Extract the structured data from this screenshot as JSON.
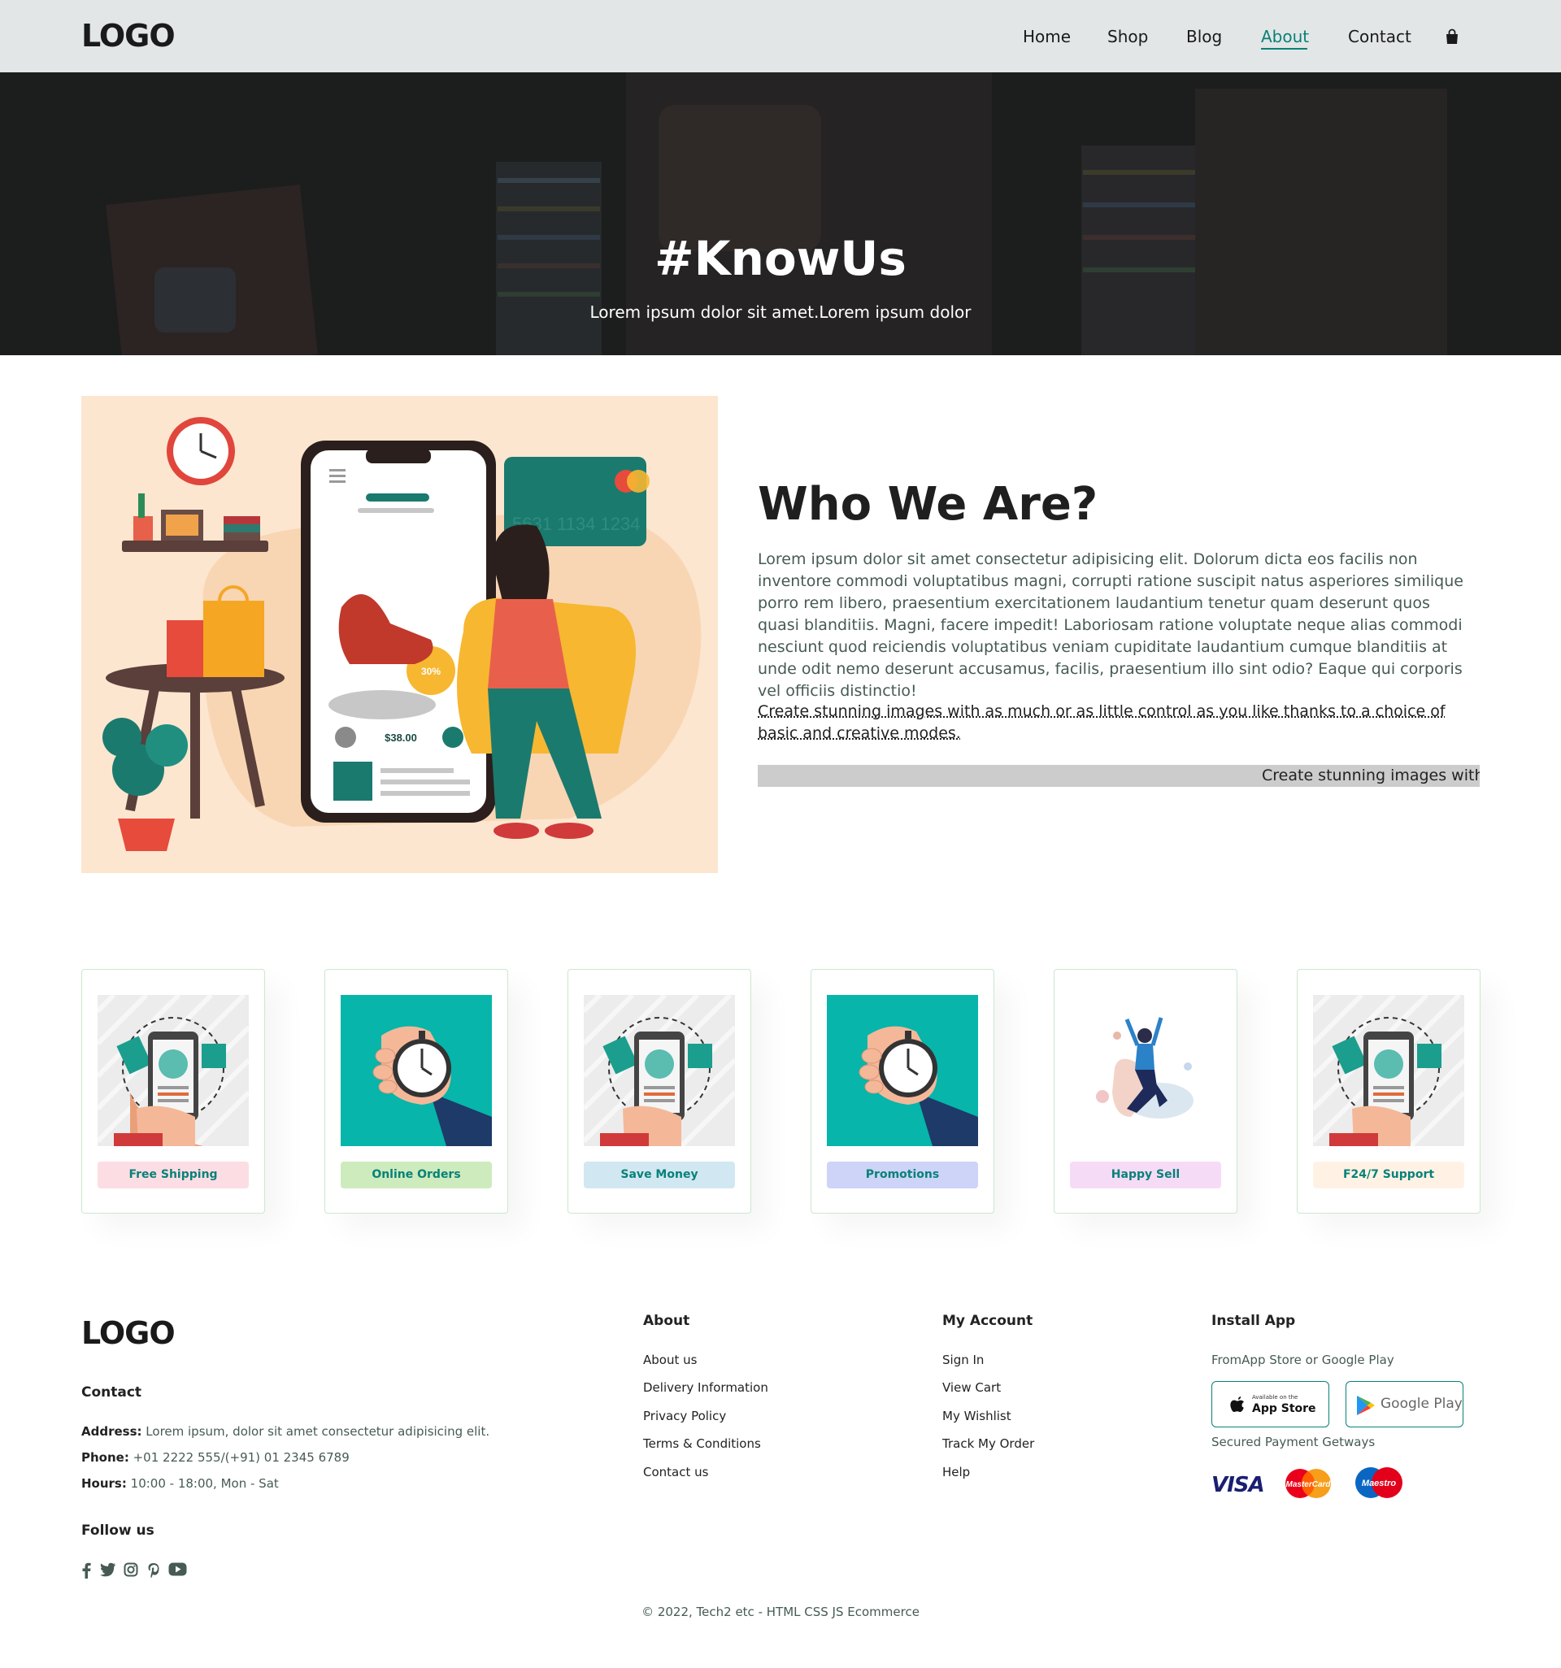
{
  "header": {
    "logo": "LOGO",
    "nav": [
      "Home",
      "Shop",
      "Blog",
      "About",
      "Contact"
    ],
    "active": "About",
    "cart_icon": "shopping-bag-icon"
  },
  "hero": {
    "title": "#KnowUs",
    "subtitle": "Lorem ipsum dolor sit amet.Lorem ipsum dolor"
  },
  "about": {
    "illustration": {
      "price": "$38.00",
      "discount": "30%",
      "card_number": "5631 1134 1234"
    },
    "title": "Who We Are?",
    "paragraph": "Lorem ipsum dolor sit amet consectetur adipisicing elit. Dolorum dicta eos facilis non inventore commodi voluptatibus magni, corrupti ratione suscipit natus asperiores similique porro rem libero, praesentium exercitationem laudantium tenetur quam deserunt quos quasi blanditiis. Magni, facere impedit! Laboriosam ratione voluptate neque alias commodi nesciunt quod reiciendis voluptatibus veniam cupiditate laudantium cumque blanditiis at unde odit nemo deserunt accusamus, facilis, praesentium illo sint odio? Eaque qui corporis vel officiis distinctio!",
    "link_text": "Create stunning images with as much or as little control as you like thanks to a choice of basic and creative modes.",
    "marquee": "Create stunning images with a"
  },
  "features": [
    {
      "label": "Free Shipping",
      "bg": "#fddde4",
      "art": "phone"
    },
    {
      "label": "Online Orders",
      "bg": "#cdebbc",
      "art": "stopwatch"
    },
    {
      "label": "Save Money",
      "bg": "#d1e8f2",
      "art": "phone"
    },
    {
      "label": "Promotions",
      "bg": "#cdd4f8",
      "art": "stopwatch"
    },
    {
      "label": "Happy Sell",
      "bg": "#f6dbf6",
      "art": "person"
    },
    {
      "label": "F24/7 Support",
      "bg": "#fff2e5",
      "art": "phone"
    }
  ],
  "footer": {
    "logo": "LOGO",
    "contact_heading": "Contact",
    "address_label": "Address:",
    "address": "Lorem ipsum, dolor sit amet consectetur adipisicing elit.",
    "phone_label": "Phone:",
    "phone": "+01 2222 555/(+91) 01 2345 6789",
    "hours_label": "Hours:",
    "hours": "10:00 - 18:00, Mon - Sat",
    "follow_heading": "Follow us",
    "social_icons": [
      "facebook-icon",
      "twitter-icon",
      "instagram-icon",
      "pinterest-icon",
      "youtube-icon"
    ],
    "about_heading": "About",
    "about_links": [
      "About us",
      "Delivery Information",
      "Privacy Policy",
      "Terms & Conditions",
      "Contact us"
    ],
    "account_heading": "My Account",
    "account_links": [
      "Sign In",
      "View Cart",
      "My Wishlist",
      "Track My Order",
      "Help"
    ],
    "app_heading": "Install App",
    "app_sub": "FromApp Store or Google Play",
    "app_store_small": "Available on the",
    "app_store": "App Store",
    "google_play": "Google Play",
    "payments_heading": "Secured Payment Getways",
    "payments": [
      "VISA",
      "MasterCard",
      "Maestro"
    ],
    "copyright": "© 2022, Tech2 etc - HTML CSS JS Ecommerce"
  }
}
